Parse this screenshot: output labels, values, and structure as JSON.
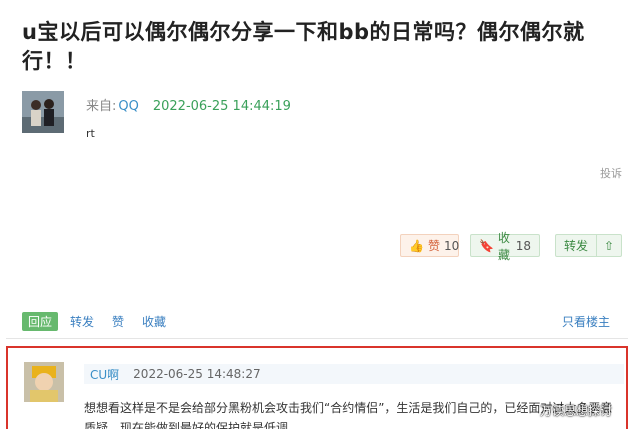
{
  "post": {
    "title": "u宝以后可以偶尔偶尔分享一下和bb的日常吗？偶尔偶尔就行！！",
    "from_label": "来自:",
    "source": "QQ",
    "timestamp": "2022-06-25 14:44:19",
    "body": "rt",
    "report_label": "投诉"
  },
  "actions": {
    "like_label": "赞",
    "like_count": "10",
    "collect_label": "收藏",
    "collect_count": "18",
    "share_label": "转发",
    "like_icon": "thumbs-up-icon",
    "collect_icon": "bookmark-icon",
    "share_icon": "upload-icon"
  },
  "reply_bar": {
    "reply": "回应",
    "forward": "转发",
    "like": "赞",
    "collect": "收藏",
    "only_op": "只看楼主"
  },
  "comment": {
    "user": "CU啊",
    "timestamp": "2022-06-25 14:48:27",
    "text": "想想看这样是不是会给部分黑粉机会攻击我们“合约情侣”，生活是我们自己的，已经面对过太多恶意质疑，现在能做到最好的保护就是低调"
  },
  "watermark": "万读思想探讨",
  "colors": {
    "accent_green": "#67b96e",
    "link_blue": "#3a7fc0",
    "highlight_red": "#d9342b"
  }
}
